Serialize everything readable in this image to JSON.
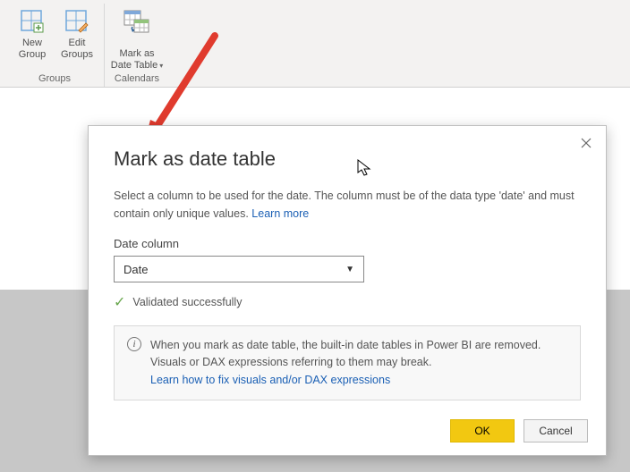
{
  "ribbon": {
    "groups": [
      {
        "label": "Groups",
        "buttons": [
          {
            "label": "New\nGroup"
          },
          {
            "label": "Edit\nGroups"
          }
        ]
      },
      {
        "label": "Calendars",
        "buttons": [
          {
            "label": "Mark as\nDate Table",
            "has_dropdown": true
          }
        ]
      }
    ]
  },
  "dialog": {
    "title": "Mark as date table",
    "description": "Select a column to be used for the date. The column must be of the data type 'date' and must contain only unique values.",
    "learn_more": "Learn more",
    "field_label": "Date column",
    "selected_value": "Date",
    "validated_text": "Validated successfully",
    "info_text": "When you mark as date table, the built-in date tables in Power BI are removed. Visuals or DAX expressions referring to them may break.",
    "info_link": "Learn how to fix visuals and/or DAX expressions",
    "ok_label": "OK",
    "cancel_label": "Cancel"
  }
}
